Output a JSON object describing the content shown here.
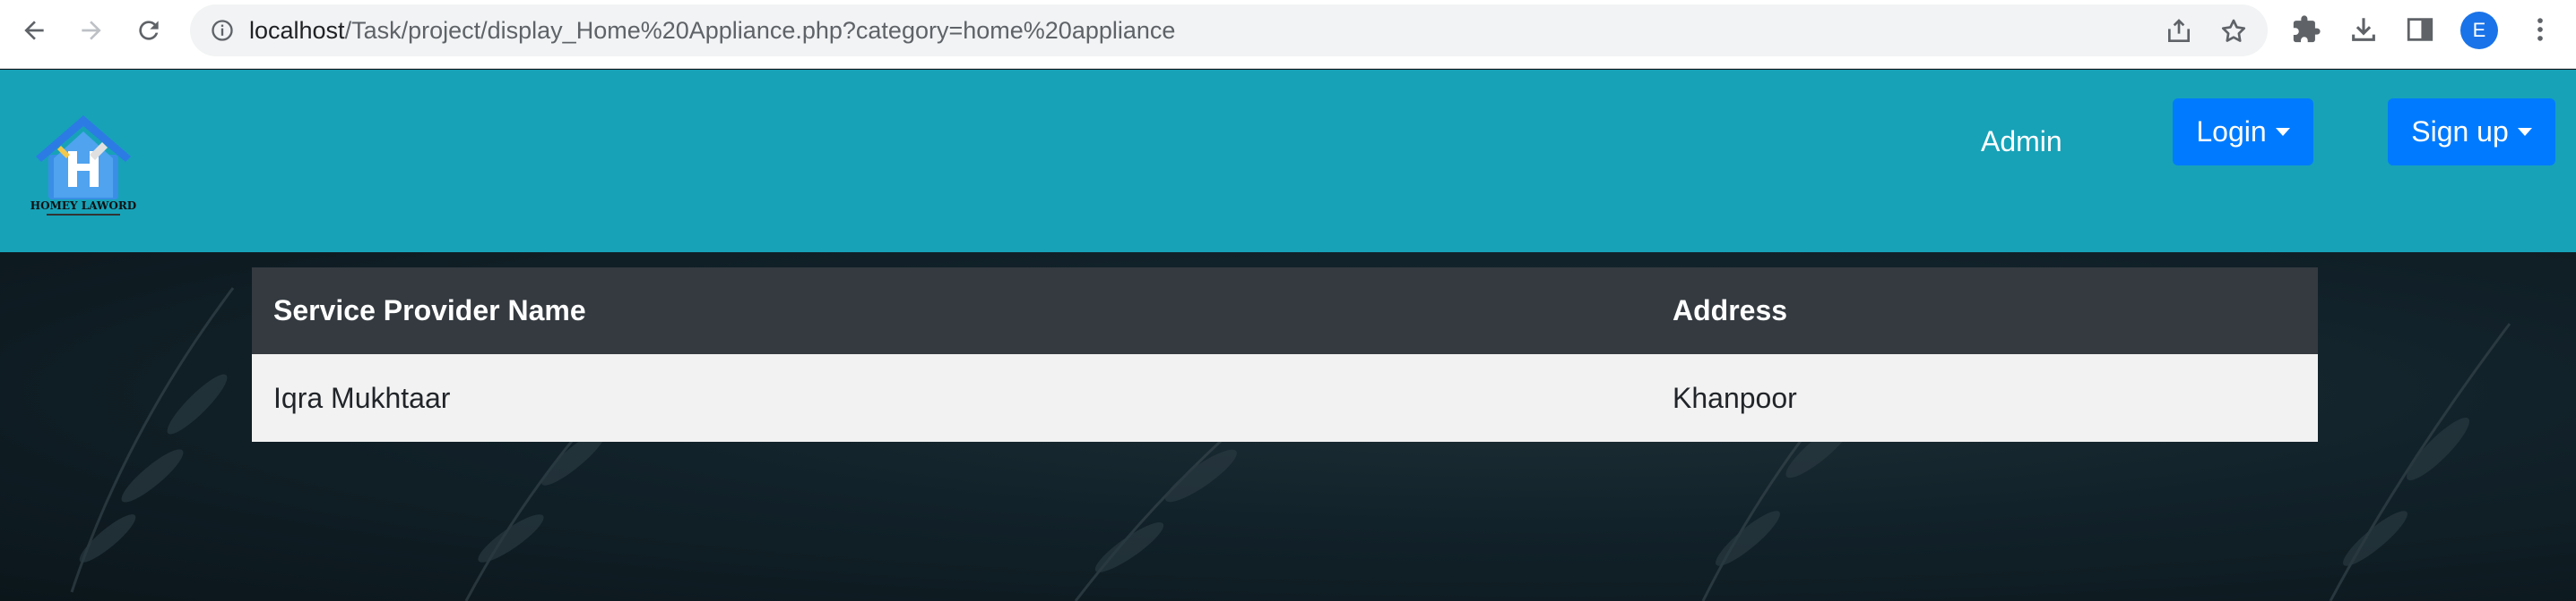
{
  "browser": {
    "url_host": "localhost",
    "url_path": "/Task/project/display_Home%20Appliance.php?category=home%20appliance",
    "profile_initial": "E",
    "icons": [
      "back-icon",
      "forward-icon",
      "reload-icon",
      "info-icon",
      "share-icon",
      "star-icon",
      "extensions-icon",
      "download-icon",
      "sidepanel-icon",
      "menu-icon"
    ]
  },
  "header": {
    "logo_text": "HOMEY LAWORD",
    "nav_admin": "Admin",
    "login_label": "Login",
    "signup_label": "Sign up",
    "colors": {
      "header_bg": "#17a2b8",
      "button_bg": "#007bff"
    }
  },
  "table": {
    "columns": [
      "Service Provider Name",
      "Address"
    ],
    "rows": [
      [
        "Iqra Mukhtaar",
        "Khanpoor"
      ]
    ]
  }
}
